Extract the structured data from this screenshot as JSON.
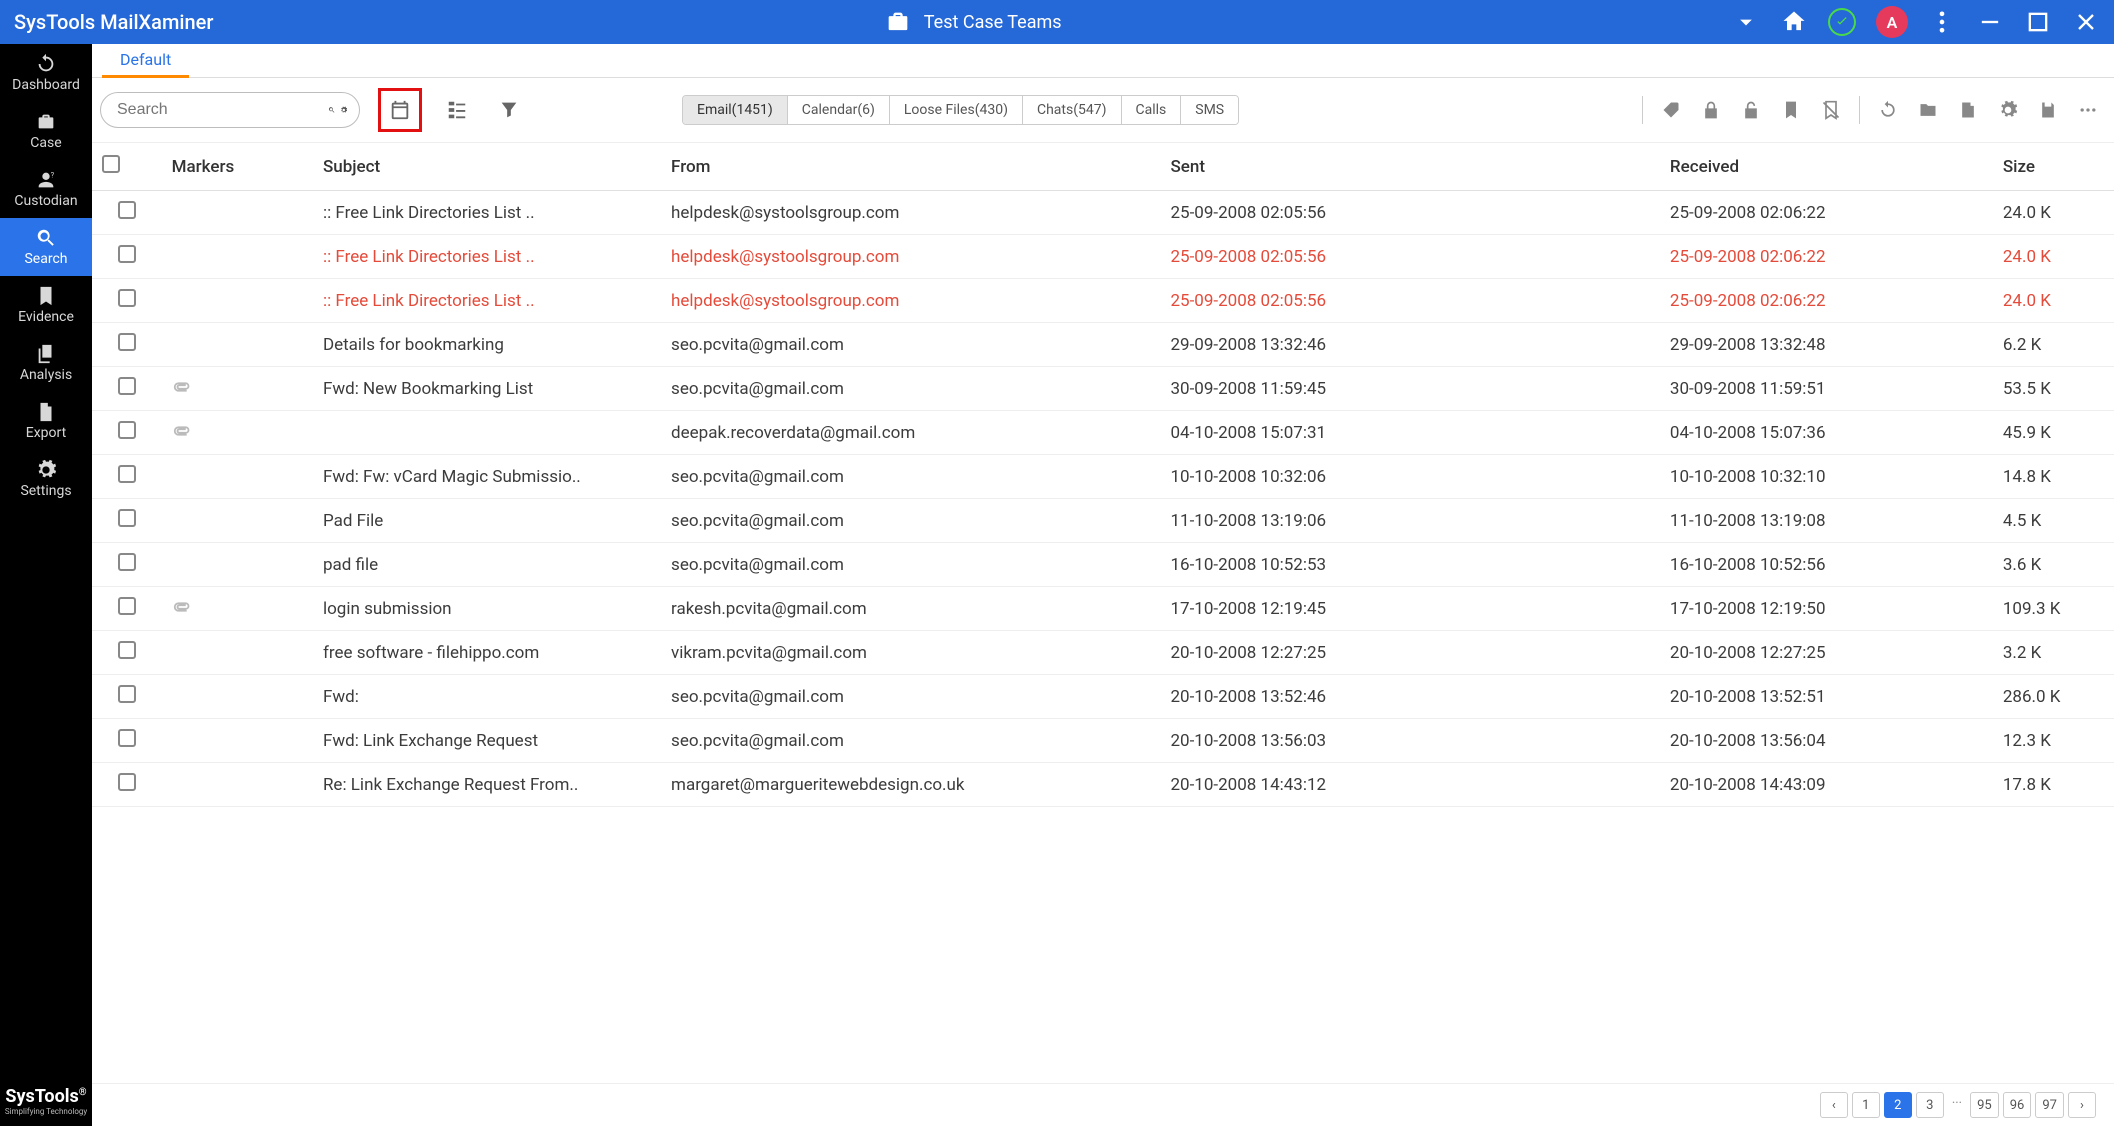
{
  "titlebar": {
    "app_title": "SysTools MailXaminer",
    "case_label": "Test Case Teams",
    "avatar_letter": "A"
  },
  "sidebar": {
    "items": [
      {
        "label": "Dashboard",
        "icon": "refresh"
      },
      {
        "label": "Case",
        "icon": "briefcase"
      },
      {
        "label": "Custodian",
        "icon": "person-q"
      },
      {
        "label": "Search",
        "icon": "search",
        "active": true
      },
      {
        "label": "Evidence",
        "icon": "bookmark"
      },
      {
        "label": "Analysis",
        "icon": "copy"
      },
      {
        "label": "Export",
        "icon": "file"
      },
      {
        "label": "Settings",
        "icon": "gear"
      }
    ],
    "brand": "SysTools",
    "brand_tag": "Simplifying Technology"
  },
  "tabs": {
    "active": "Default"
  },
  "toolbar": {
    "search_placeholder": "Search",
    "chips": [
      {
        "label": "Email(1451)",
        "active": true
      },
      {
        "label": "Calendar(6)"
      },
      {
        "label": "Loose Files(430)"
      },
      {
        "label": "Chats(547)"
      },
      {
        "label": "Calls"
      },
      {
        "label": "SMS"
      }
    ]
  },
  "columns": {
    "cb": "",
    "markers": "Markers",
    "subject": "Subject",
    "from": "From",
    "sent": "Sent",
    "received": "Received",
    "size": "Size"
  },
  "rows": [
    {
      "subject": ":: Free Link Directories List ..",
      "from": "helpdesk@systoolsgroup.com",
      "sent": "25-09-2008 02:05:56",
      "received": "25-09-2008 02:06:22",
      "size": "24.0 K"
    },
    {
      "subject": ":: Free Link Directories List ..",
      "from": "helpdesk@systoolsgroup.com",
      "sent": "25-09-2008 02:05:56",
      "received": "25-09-2008 02:06:22",
      "size": "24.0 K",
      "flagged": true
    },
    {
      "subject": ":: Free Link Directories List ..",
      "from": "helpdesk@systoolsgroup.com",
      "sent": "25-09-2008 02:05:56",
      "received": "25-09-2008 02:06:22",
      "size": "24.0 K",
      "flagged": true
    },
    {
      "subject": "Details for bookmarking",
      "from": "seo.pcvita@gmail.com",
      "sent": "29-09-2008 13:32:46",
      "received": "29-09-2008 13:32:48",
      "size": "6.2 K"
    },
    {
      "subject": "Fwd: New Bookmarking List",
      "from": "seo.pcvita@gmail.com",
      "sent": "30-09-2008 11:59:45",
      "received": "30-09-2008 11:59:51",
      "size": "53.5 K",
      "attach": true
    },
    {
      "subject": "",
      "from": "deepak.recoverdata@gmail.com",
      "sent": "04-10-2008 15:07:31",
      "received": "04-10-2008 15:07:36",
      "size": "45.9 K",
      "attach": true
    },
    {
      "subject": "Fwd: Fw: vCard Magic Submissio..",
      "from": "seo.pcvita@gmail.com",
      "sent": "10-10-2008 10:32:06",
      "received": "10-10-2008 10:32:10",
      "size": "14.8 K"
    },
    {
      "subject": "Pad File",
      "from": "seo.pcvita@gmail.com",
      "sent": "11-10-2008 13:19:06",
      "received": "11-10-2008 13:19:08",
      "size": "4.5 K"
    },
    {
      "subject": "pad file",
      "from": "seo.pcvita@gmail.com",
      "sent": "16-10-2008 10:52:53",
      "received": "16-10-2008 10:52:56",
      "size": "3.6 K"
    },
    {
      "subject": "login submission",
      "from": "rakesh.pcvita@gmail.com",
      "sent": "17-10-2008 12:19:45",
      "received": "17-10-2008 12:19:50",
      "size": "109.3 K",
      "attach": true
    },
    {
      "subject": "free software - filehippo.com",
      "from": "vikram.pcvita@gmail.com",
      "sent": "20-10-2008 12:27:25",
      "received": "20-10-2008 12:27:25",
      "size": "3.2 K"
    },
    {
      "subject": "Fwd:",
      "from": "seo.pcvita@gmail.com",
      "sent": "20-10-2008 13:52:46",
      "received": "20-10-2008 13:52:51",
      "size": "286.0 K"
    },
    {
      "subject": "Fwd: Link Exchange Request",
      "from": "seo.pcvita@gmail.com",
      "sent": "20-10-2008 13:56:03",
      "received": "20-10-2008 13:56:04",
      "size": "12.3 K"
    },
    {
      "subject": "Re: Link Exchange Request From..",
      "from": "margaret@margueritewebdesign.co.uk",
      "sent": "20-10-2008 14:43:12",
      "received": "20-10-2008 14:43:09",
      "size": "17.8 K"
    }
  ],
  "pager": {
    "pages": [
      "1",
      "2",
      "3",
      "...",
      "95",
      "96",
      "97"
    ],
    "active": "2"
  }
}
